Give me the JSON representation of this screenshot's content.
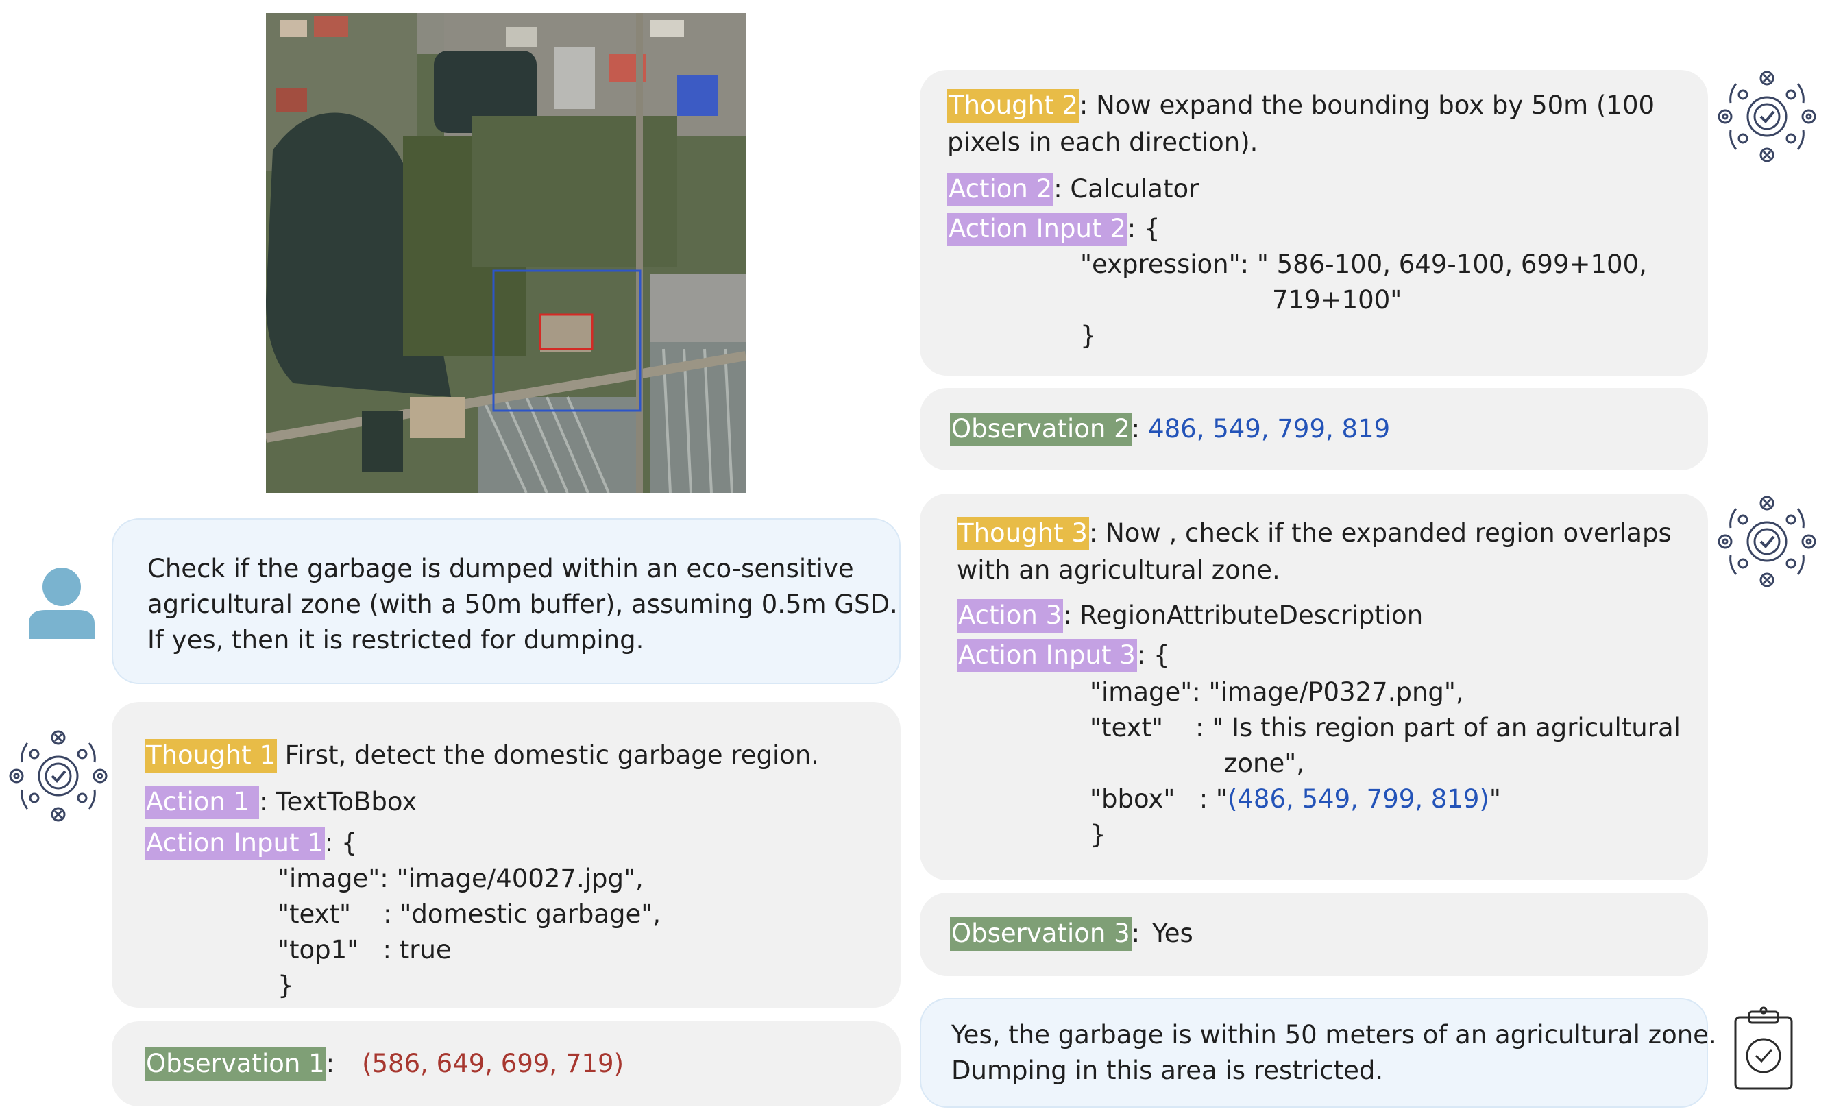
{
  "query": {
    "line1": "Check if the garbage is dumped within an eco-sensitive",
    "line2": "agricultural zone (with a 50m buffer), assuming 0.5m GSD.",
    "line3": "If yes, then it is restricted for dumping."
  },
  "step1": {
    "thought_tag": "Thought 1",
    "thought_text": " First, detect the domestic garbage region.",
    "action_tag": "Action 1 ",
    "action_text": ": TextToBbox",
    "input_tag": "Action Input 1",
    "input_open": ": {",
    "arg1": "\"image\": \"image/40027.jpg\",",
    "arg2": "\"text\"    : \"domestic garbage\",",
    "arg3": "\"top1\"   : true",
    "close": "}",
    "obs_tag": "Observation 1",
    "obs_sep": ":",
    "obs_value": "(586, 649, 699, 719)"
  },
  "step2": {
    "thought_tag": "Thought 2",
    "thought_text1": ": Now expand the bounding box by 50m (100",
    "thought_text2": "pixels in each direction).",
    "action_tag": "Action 2",
    "action_text": ": Calculator",
    "input_tag": "Action Input 2",
    "input_open": ": {",
    "arg1": "\"expression\": \" 586-100, 649-100, 699+100,",
    "arg1b": "719+100\"",
    "close": "}",
    "obs_tag": "Observation 2",
    "obs_sep": ":",
    "obs_value": "486, 549, 799, 819"
  },
  "step3": {
    "thought_tag": "Thought 3",
    "thought_text1": ": Now , check if the expanded region overlaps",
    "thought_text2": "with an agricultural zone.",
    "action_tag": "Action 3",
    "action_text": ": RegionAttributeDescription",
    "input_tag": "Action Input 3",
    "input_open": ": {",
    "arg1": "\"image\": \"image/P0327.png\",",
    "arg2": "\"text\"    : \" Is this region part of an agricultural",
    "arg2b": "zone\",",
    "arg3_pre": "\"bbox\"   : \"",
    "arg3_val": "(486, 549, 799, 819)",
    "arg3_post": "\"",
    "close": "}",
    "obs_tag": "Observation 3",
    "obs_sep": ":",
    "obs_value": "Yes"
  },
  "answer": {
    "line1": "Yes, the garbage is within 50 meters of an agricultural zone.",
    "line2": "Dumping in this area is restricted."
  },
  "icons": {
    "user": "user-icon",
    "agent": "gear-check-icon",
    "result": "clipboard-check-icon"
  },
  "colors": {
    "thought": "#e8bc47",
    "action": "#c4a1e3",
    "observation": "#7f9f76",
    "red_value": "#a7372f",
    "blue_value": "#2353b8"
  }
}
